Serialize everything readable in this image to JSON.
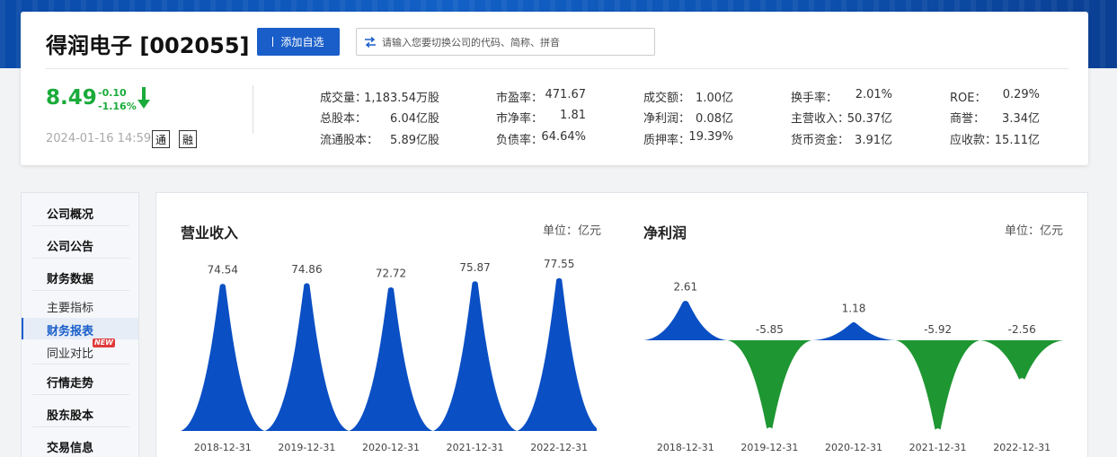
{
  "header": {
    "title": "得润电子 [002055]",
    "add_button": "添加自选",
    "search_placeholder": "请输入您要切换公司的代码、简称、拼音"
  },
  "quote": {
    "price": "8.49",
    "change": "-0.10",
    "change_pct": "-1.16%",
    "timestamp": "2024-01-16 14:59",
    "tags": [
      "通",
      "融"
    ],
    "accent_color": "#1aab3a"
  },
  "stats": [
    [
      {
        "label": "成交量：",
        "value": "1,183.54万股"
      },
      {
        "label": "总股本：",
        "value": "6.04亿股"
      },
      {
        "label": "流通股本：",
        "value": "5.89亿股"
      }
    ],
    [
      {
        "label": "市盈率：",
        "value": "471.67"
      },
      {
        "label": "市净率：",
        "value": "1.81"
      },
      {
        "label": "负债率：",
        "value": "64.64%"
      }
    ],
    [
      {
        "label": "成交额：",
        "value": "1.00亿"
      },
      {
        "label": "净利润：",
        "value": "0.08亿"
      },
      {
        "label": "质押率：",
        "value": "19.39%"
      }
    ],
    [
      {
        "label": "换手率：",
        "value": "2.01%"
      },
      {
        "label": "主营收入：",
        "value": "50.37亿"
      },
      {
        "label": "货币资金：",
        "value": "3.91亿"
      }
    ],
    [
      {
        "label": "ROE：",
        "value": "0.29%"
      },
      {
        "label": "商誉：",
        "value": "3.34亿"
      },
      {
        "label": "应收款：",
        "value": "15.11亿"
      }
    ]
  ],
  "sidebar": {
    "items": [
      "公司概况",
      "公司公告",
      "财务数据",
      "行情走势",
      "股东股本",
      "交易信息"
    ],
    "sub_items": [
      "主要指标",
      "财务报表",
      "同业对比"
    ],
    "active": "财务报表",
    "new_badge": "NEW"
  },
  "chart_data": [
    {
      "type": "area",
      "title": "营业收入",
      "unit_label": "单位：亿元",
      "categories": [
        "2018-12-31",
        "2019-12-31",
        "2020-12-31",
        "2021-12-31",
        "2022-12-31"
      ],
      "values": [
        74.54,
        74.86,
        72.72,
        75.87,
        77.55
      ],
      "labels": [
        "74.54",
        "74.86",
        "72.72",
        "75.87",
        "77.55"
      ],
      "color": "#0a4fc4"
    },
    {
      "type": "area",
      "title": "净利润",
      "unit_label": "单位：亿元",
      "categories": [
        "2018-12-31",
        "2019-12-31",
        "2020-12-31",
        "2021-12-31",
        "2022-12-31"
      ],
      "values": [
        2.61,
        -5.85,
        1.18,
        -5.92,
        -2.56
      ],
      "labels": [
        "2.61",
        "-5.85",
        "1.18",
        "-5.92",
        "-2.56"
      ],
      "positive_color": "#0a4fc4",
      "negative_color": "#1e9632"
    }
  ]
}
